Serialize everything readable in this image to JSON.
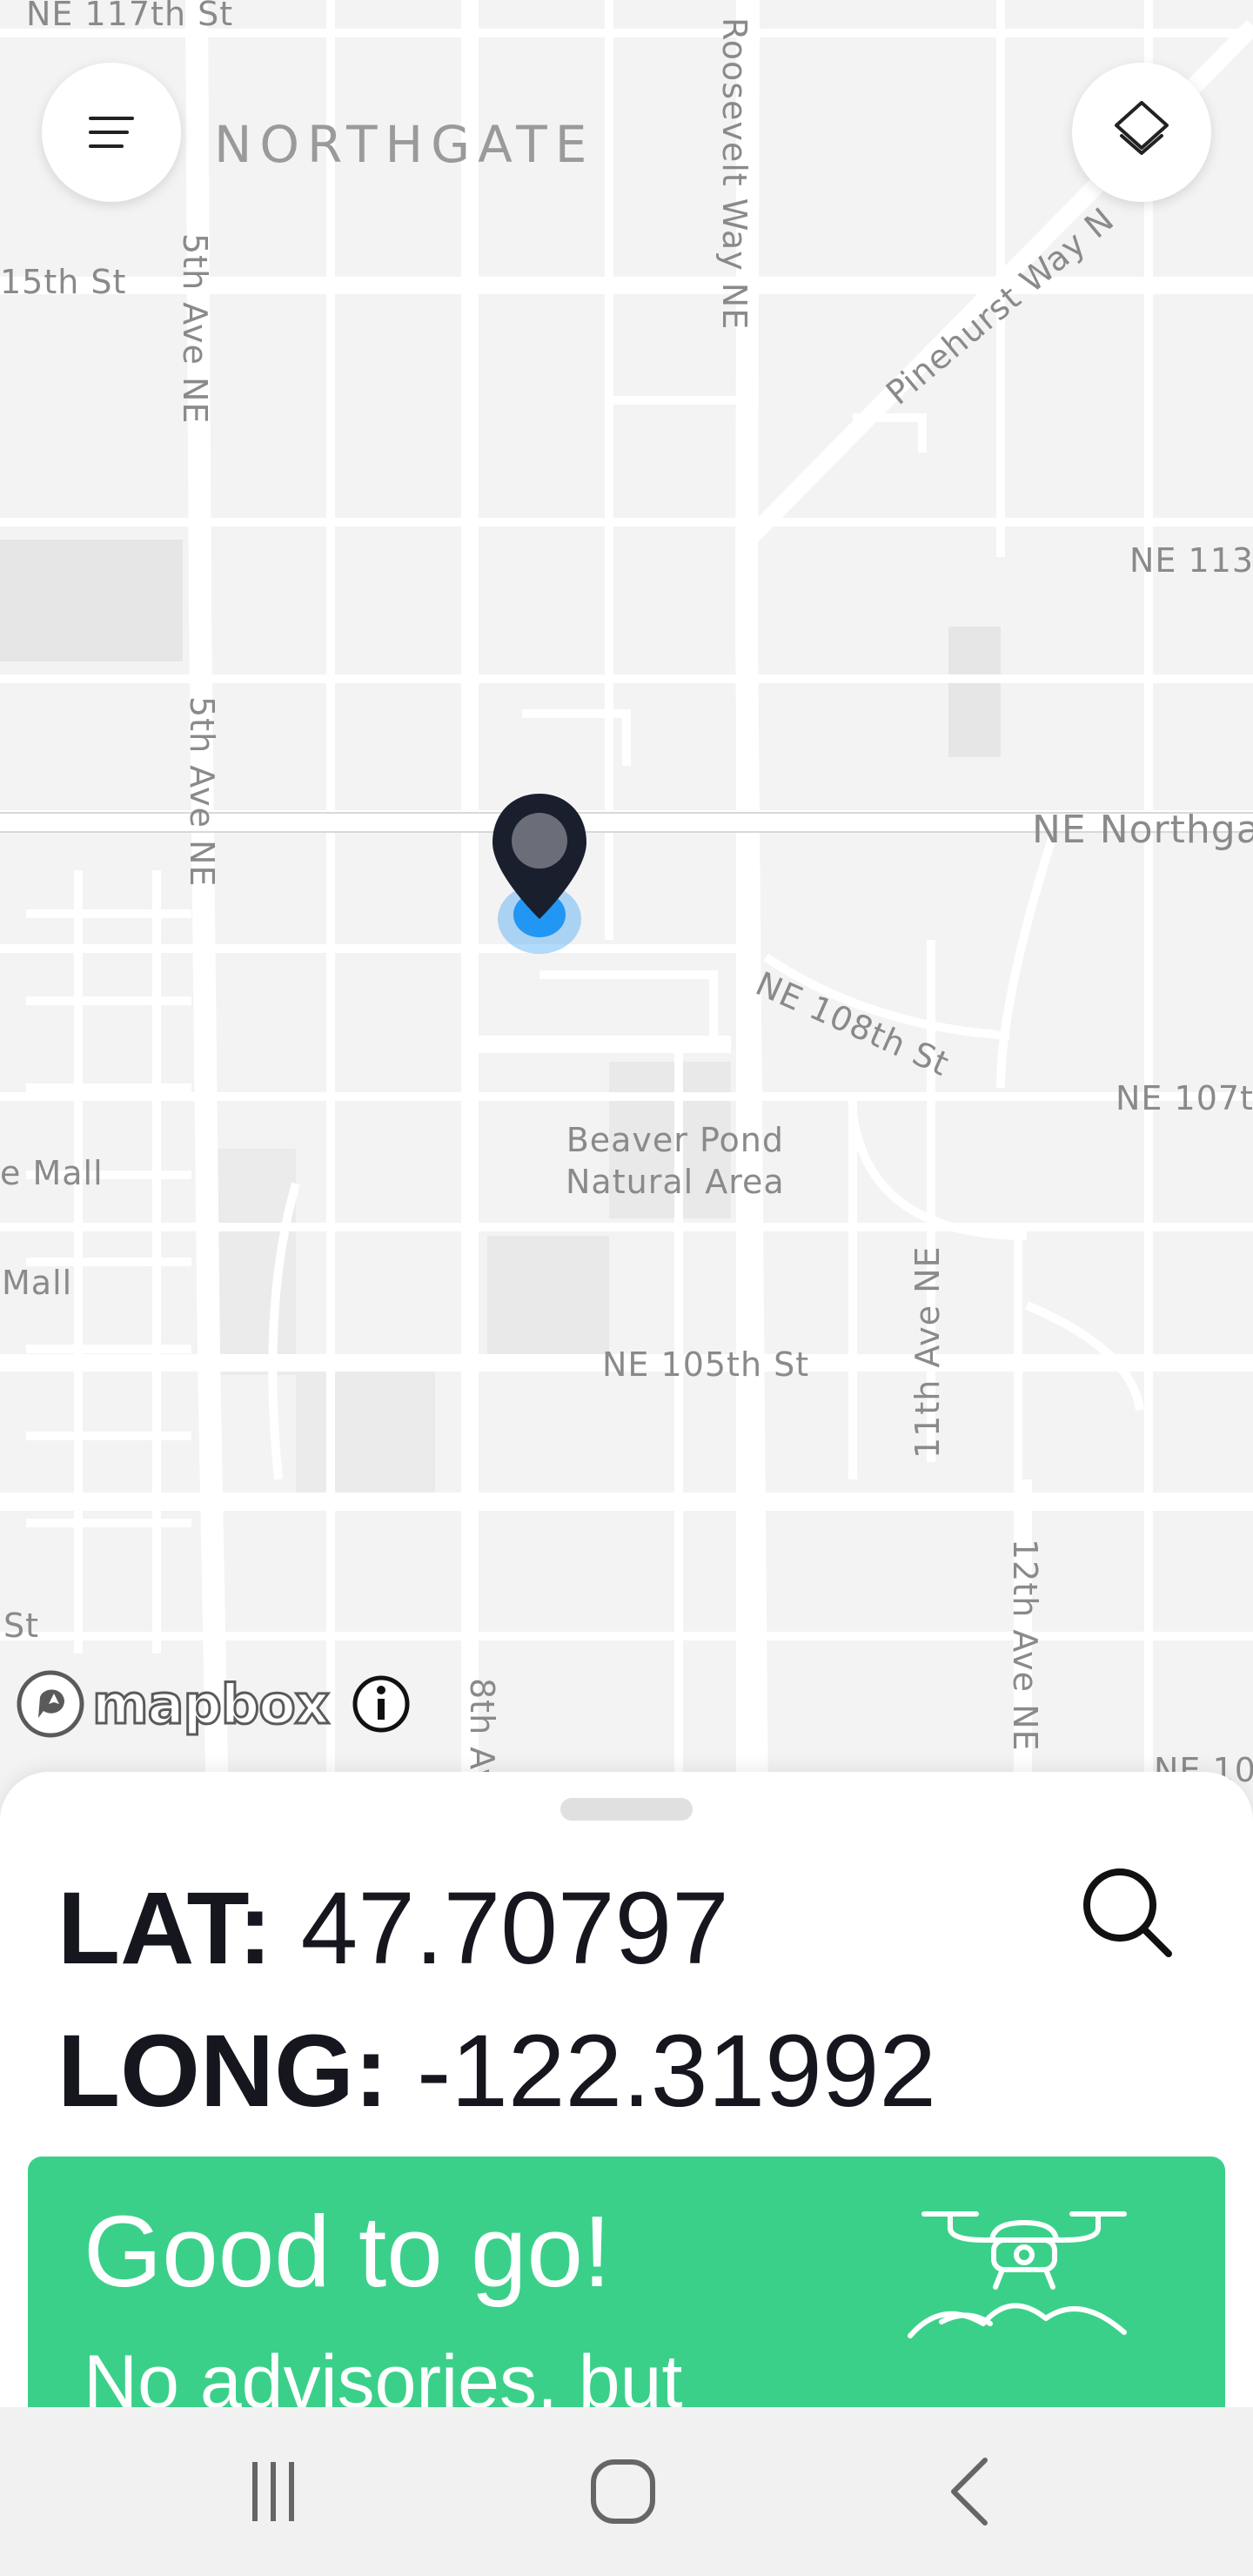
{
  "map": {
    "neighborhood": "NORTHGATE",
    "streets": {
      "ne_117th": "NE 117th St",
      "st_115th": "15th St",
      "fifth_ave_top": "5th Ave NE",
      "fifth_ave_mid": "5th Ave NE",
      "roosevelt": "Roosevelt Way NE",
      "pinehurst": "Pinehurst Way N",
      "ne_113": "NE 113",
      "ne_northgate": "NE Northga",
      "ne_108th": "NE 108th St",
      "ne_107th": "NE 107th",
      "e_mall": "e Mall",
      "mall": "Mall",
      "ne_105th": "NE 105th St",
      "eleventh_ave": "11th Ave NE",
      "twelfth_ave": "12th Ave NE",
      "st_bottom": "St",
      "eighth_ave": "8th Av",
      "ne_10": "NE 10"
    },
    "park_label_line1": "Beaver Pond",
    "park_label_line2": "Natural Area",
    "attribution": "mapbox",
    "icons": {
      "menu": "menu-icon",
      "layers": "layers-icon",
      "pin": "location-pin-icon",
      "info": "info-icon"
    }
  },
  "sheet": {
    "lat_label": "LAT:",
    "lat_value": "47.70797",
    "long_label": "LONG:",
    "long_value": "-122.31992",
    "search_icon": "search-icon",
    "status": {
      "title": "Good to go!",
      "subtitle": "No advisories, but",
      "color": "#3bd08a",
      "icon": "drone-icon"
    }
  },
  "navbar": {
    "icons": [
      "recents-icon",
      "home-icon",
      "back-icon"
    ]
  },
  "colors": {
    "pin": "#1a1f2e",
    "location_dot": "#2196f3",
    "text": "#16161e"
  }
}
